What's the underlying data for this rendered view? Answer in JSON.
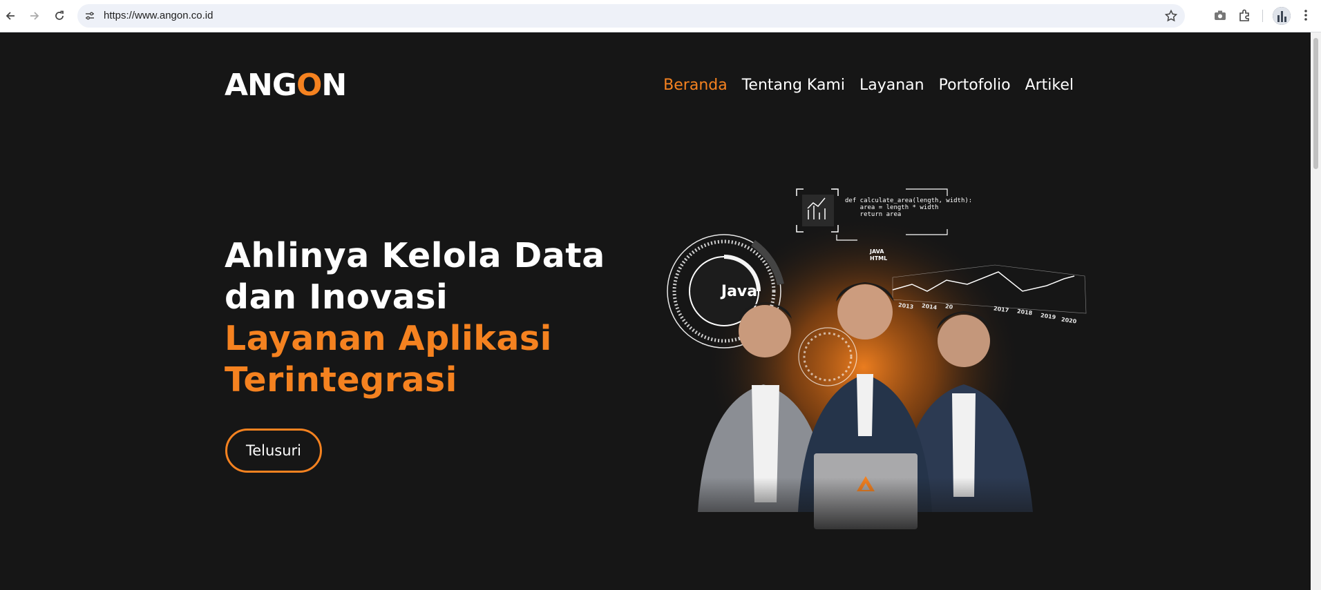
{
  "browser": {
    "url": "https://www.angon.co.id",
    "icons": [
      "back-arrow-icon",
      "forward-arrow-icon",
      "reload-icon",
      "site-info-icon",
      "bookmark-star-icon",
      "camera-icon",
      "extensions-icon",
      "profile-avatar",
      "kebab-menu-icon"
    ]
  },
  "site": {
    "logo": {
      "pre": "ANG",
      "accent": "O",
      "post": "N"
    },
    "nav": [
      {
        "label": "Beranda",
        "active": true
      },
      {
        "label": "Tentang Kami",
        "active": false
      },
      {
        "label": "Layanan",
        "active": false
      },
      {
        "label": "Portofolio",
        "active": false
      },
      {
        "label": "Artikel",
        "active": false
      }
    ],
    "hero": {
      "line1": "Ahlinya Kelola Data",
      "line2": "dan Inovasi",
      "line3": "Layanan Aplikasi",
      "line4": "Terintegrasi"
    },
    "cta_label": "Telusuri",
    "illustration": {
      "java_label": "Java",
      "code": "def calculate_area(length, width):\n    area = length * width\n    return area",
      "languages": [
        "JAVA",
        "HTML"
      ],
      "years": [
        "2013",
        "2014",
        "20",
        "2017",
        "2018",
        "2019",
        "2020"
      ]
    },
    "colors": {
      "accent": "#f58220",
      "background": "#161616",
      "text": "#ffffff"
    }
  }
}
